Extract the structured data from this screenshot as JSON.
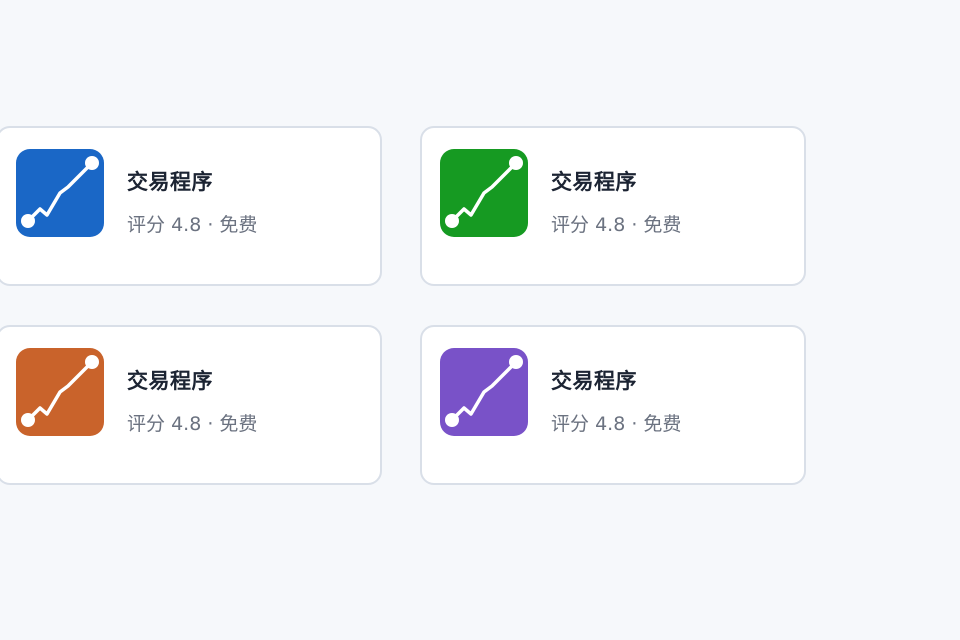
{
  "apps": [
    {
      "title": "交易程序",
      "rating_label": "评分",
      "rating": "4.8",
      "separator": "·",
      "price": "免费",
      "icon": "stock-chart-icon",
      "color": "#1a67c6"
    },
    {
      "title": "交易程序",
      "rating_label": "评分",
      "rating": "4.8",
      "separator": "·",
      "price": "免费",
      "icon": "stock-chart-icon",
      "color": "#169a22"
    },
    {
      "title": "交易程序",
      "rating_label": "评分",
      "rating": "4.8",
      "separator": "·",
      "price": "免费",
      "icon": "stock-chart-icon",
      "color": "#c9632b"
    },
    {
      "title": "交易程序",
      "rating_label": "评分",
      "rating": "4.8",
      "separator": "·",
      "price": "免费",
      "icon": "stock-chart-icon",
      "color": "#7952c8"
    }
  ]
}
